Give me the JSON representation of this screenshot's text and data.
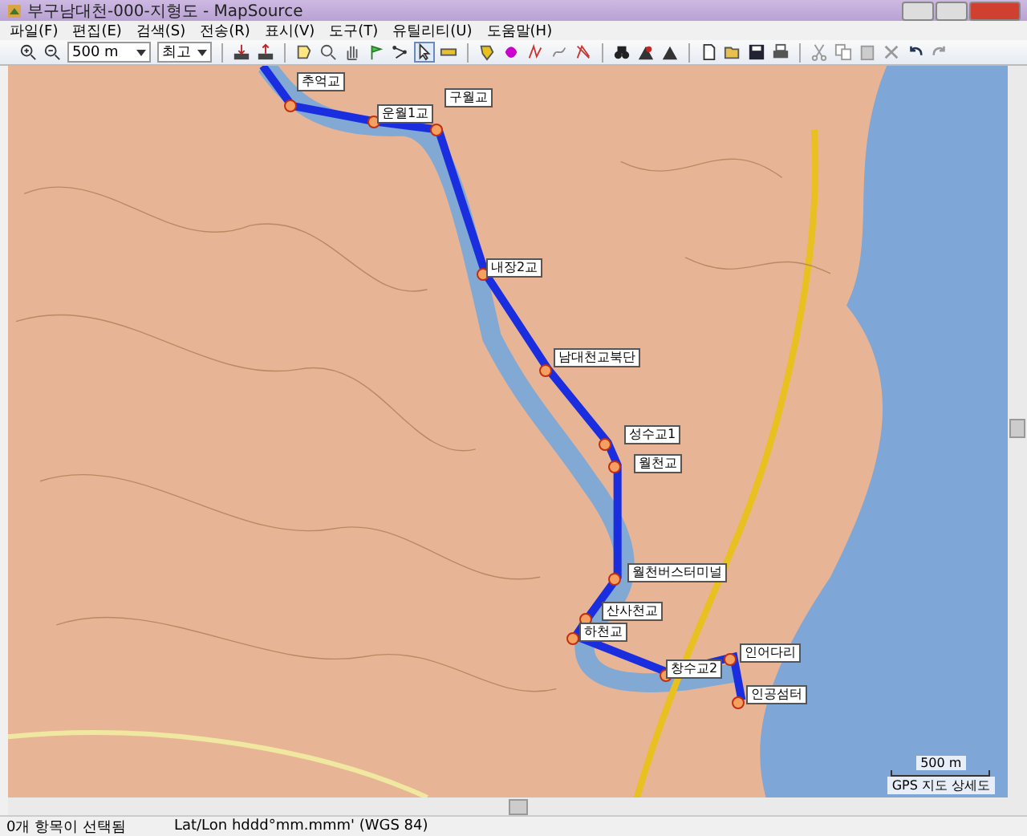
{
  "window": {
    "title": "부구남대천-000-지형도 - MapSource"
  },
  "menu": [
    "파일(F)",
    "편집(E)",
    "검색(S)",
    "전송(R)",
    "표시(V)",
    "도구(T)",
    "유틸리티(U)",
    "도움말(H)"
  ],
  "toolbar": {
    "zoom_scale": "500 m",
    "detail": "최고"
  },
  "map": {
    "waypoints": [
      {
        "label": "추억교"
      },
      {
        "label": "운월1교"
      },
      {
        "label": "구월교"
      },
      {
        "label": "내장2교"
      },
      {
        "label": "남대천교북단"
      },
      {
        "label": "성수교1"
      },
      {
        "label": "월천교"
      },
      {
        "label": "월천버스터미널"
      },
      {
        "label": "산사천교"
      },
      {
        "label": "하천교"
      },
      {
        "label": "창수교2"
      },
      {
        "label": "인어다리"
      },
      {
        "label": "인공섬터"
      }
    ],
    "scale_label": "500 m",
    "map_name": "GPS 지도 상세도"
  },
  "status_bar": {
    "selection": "0개 항목이 선택됨",
    "coordinates": "Lat/Lon hddd°mm.mmm' (WGS 84)"
  }
}
